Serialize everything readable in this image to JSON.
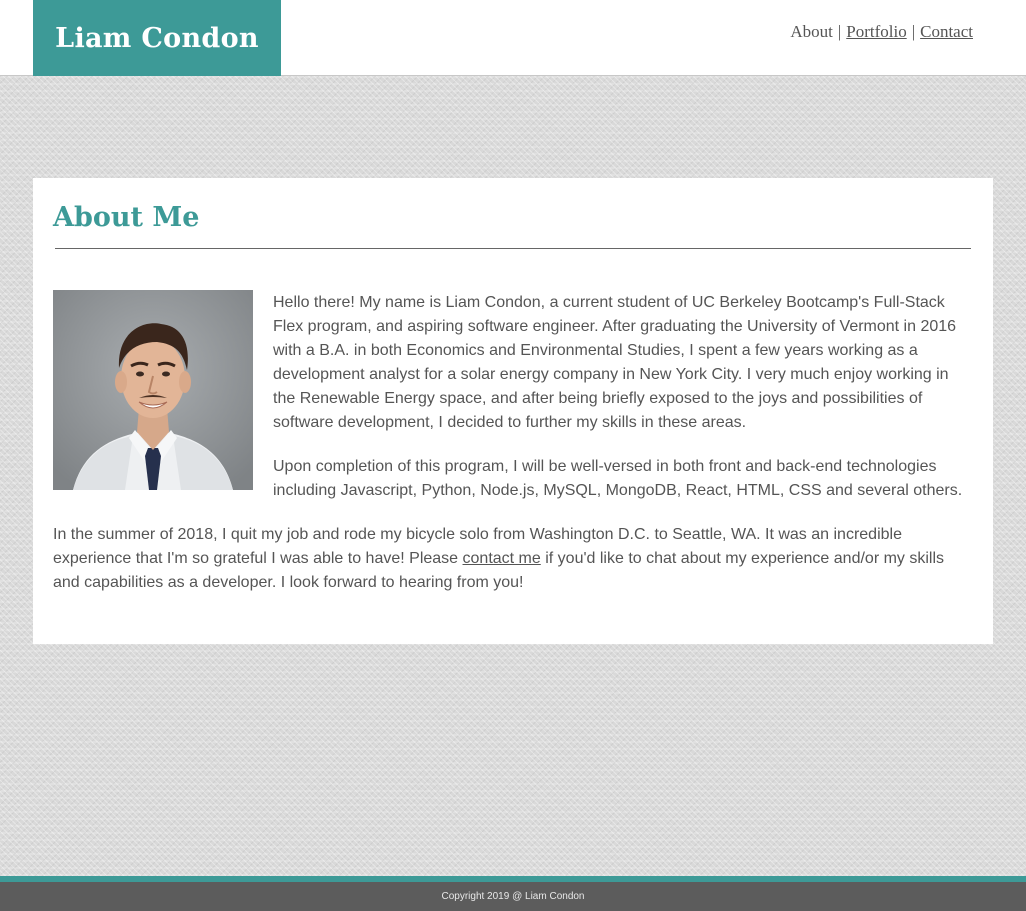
{
  "header": {
    "logo_text": "Liam Condon",
    "nav": {
      "about": "About",
      "portfolio": "Portfolio",
      "contact": "Contact",
      "separator": "|"
    }
  },
  "about": {
    "title": "About Me",
    "paragraph_1": "Hello there! My name is Liam Condon, a current student of UC Berkeley Bootcamp's Full-Stack Flex program, and aspiring software engineer. After graduating the University of Vermont in 2016 with a B.A. in both Economics and Environmental Studies, I spent a few years working as a development analyst for a solar energy company in New York City. I very much enjoy working in the Renewable Energy space, and after being briefly exposed to the joys and possibilities of software development, I decided to further my skills in these areas.",
    "paragraph_2": "Upon completion of this program, I will be well-versed in both front and back-end technologies including Javascript, Python, Node.js, MySQL, MongoDB, React, HTML, CSS and several others.",
    "paragraph_3_before": "In the summer of 2018, I quit my job and rode my bicycle solo from Washington D.C. to Seattle, WA. It was an incredible experience that I'm so grateful I was able to have! Please ",
    "paragraph_3_link": "contact me",
    "paragraph_3_after": " if you'd like to chat about my experience and/or my skills and capabilities as a developer. I look forward to hearing from you!"
  },
  "footer": {
    "copyright": "Copyright 2019 @ Liam Condon"
  },
  "colors": {
    "accent": "#3d9a97",
    "text": "#555555",
    "footer_bg": "#5c5c5c"
  },
  "icons": {
    "profile_photo": "portrait-photo"
  }
}
